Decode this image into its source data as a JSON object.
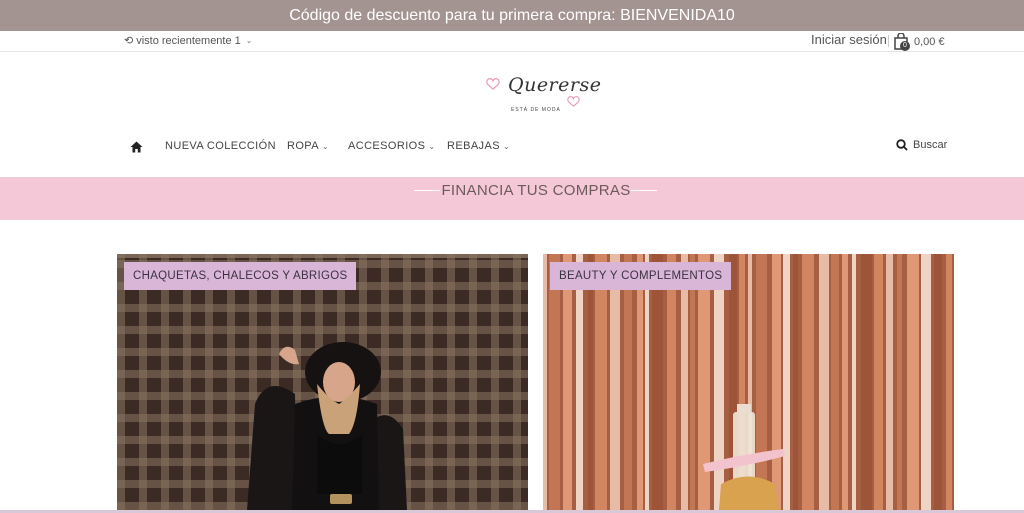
{
  "promo": {
    "text": "Código de descuento para tu primera compra: BIENVENIDA10"
  },
  "util": {
    "recent_label": "visto recientemente 1",
    "login_label": "Iniciar sesión",
    "cart_count": "0",
    "cart_total": "0,00 €"
  },
  "logo": {
    "script": "Quererse",
    "tagline": "ESTÁ DE MODA"
  },
  "nav": {
    "items": [
      {
        "label": "NUEVA COLECCIÓN"
      },
      {
        "label": "ROPA"
      },
      {
        "label": "ACCESORIOS"
      },
      {
        "label": "REBAJAS"
      }
    ],
    "search_label": "Buscar"
  },
  "finance": {
    "text": "FINANCIA TUS COMPRAS"
  },
  "tiles": [
    {
      "label": "CHAQUETAS, CHALECOS Y ABRIGOS"
    },
    {
      "label": "BEAUTY Y COMPLEMENTOS"
    }
  ],
  "colors": {
    "promo_bg": "#a39491",
    "finance_bg": "#f4c8d7",
    "badge_bg": "#d9b6d8",
    "heart": "#e79ab4"
  },
  "icons": {
    "history": "history-icon",
    "cart": "cart-bag-icon",
    "home": "home-icon",
    "search": "search-icon",
    "chevron": "chevron-down-icon"
  }
}
